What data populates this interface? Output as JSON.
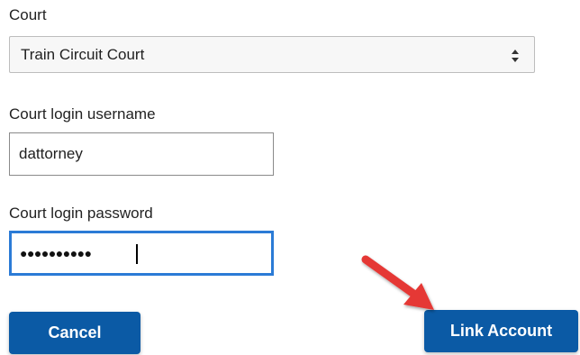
{
  "form": {
    "court_label": "Court",
    "court_selected": "Train Circuit Court",
    "username_label": "Court login username",
    "username_value": "dattorney",
    "password_label": "Court login password",
    "password_mask": "●●●●●●●●●●",
    "cancel_label": "Cancel",
    "link_account_label": "Link Account"
  },
  "colors": {
    "button": "#0b5aa5",
    "focus_border": "#2b7bd6",
    "annotation_arrow": "#e53935"
  },
  "icons": {
    "select_arrows": "sort-arrows-icon",
    "annotation": "red-arrow-annotation"
  }
}
